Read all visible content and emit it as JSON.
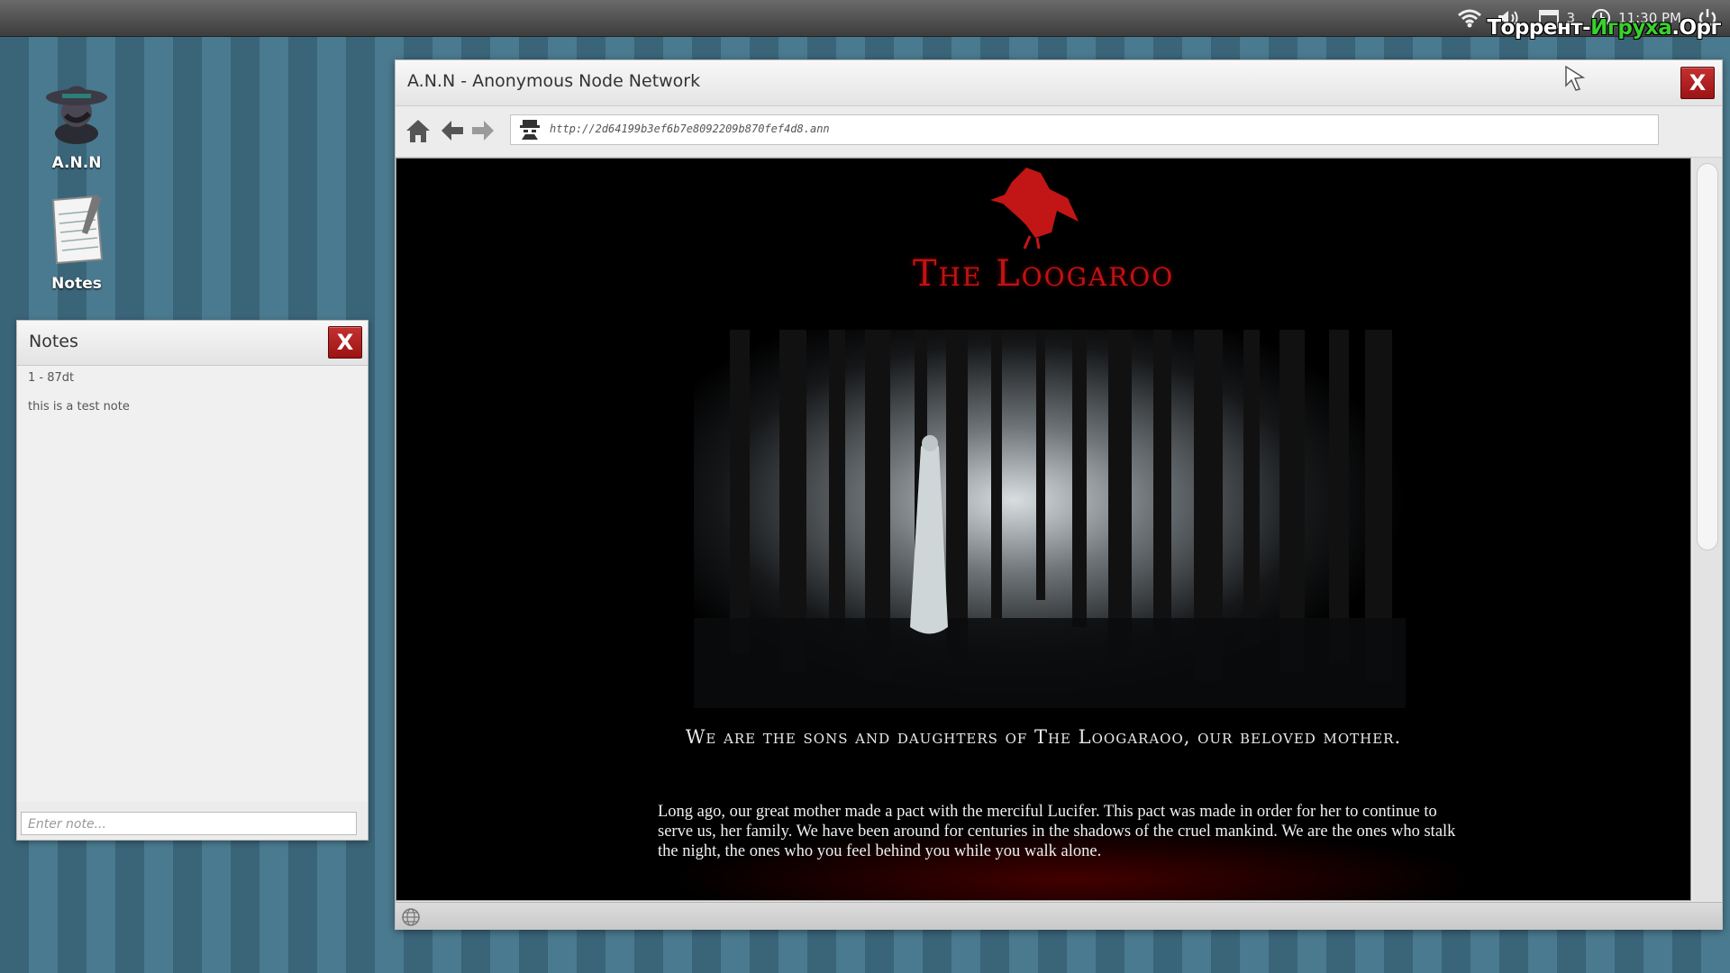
{
  "desktop": {
    "icons": [
      {
        "label": "A.N.N",
        "icon": "spy-agent-icon"
      },
      {
        "label": "Notes",
        "icon": "notepad-icon"
      }
    ],
    "tray": {
      "calendar_day": "3",
      "clock": "11:30 PM"
    },
    "watermark": {
      "part1": "Торрент-",
      "part2": "Игруха",
      "part3": ".Орг"
    }
  },
  "notes_window": {
    "title": "Notes",
    "close_label": "X",
    "notes": [
      "1 - 87dt",
      "this is a test note"
    ],
    "input_placeholder": "Enter note..."
  },
  "browser": {
    "title": "A.N.N - Anonymous Node Network",
    "close_label": "X",
    "url": "http://2d64199b3ef6b7e8092209b870fef4d8.ann",
    "page": {
      "site_title": "The Loogaroo",
      "tagline": "We are the sons and daughters of The Loogaraoo, our beloved mother.",
      "story": "Long ago, our great mother made a pact with the merciful Lucifer. This pact was made in order for her to continue to serve us, her family.  We have been around for centuries in the shadows of the cruel mankind. We are the ones who stalk the night, the ones who you feel behind you while you walk alone."
    }
  },
  "colors": {
    "close_red": "#b01c1c",
    "site_red": "#c11212",
    "desktop_stripe_dark": "#3a6478",
    "desktop_stripe_light": "#4a7a8f"
  }
}
